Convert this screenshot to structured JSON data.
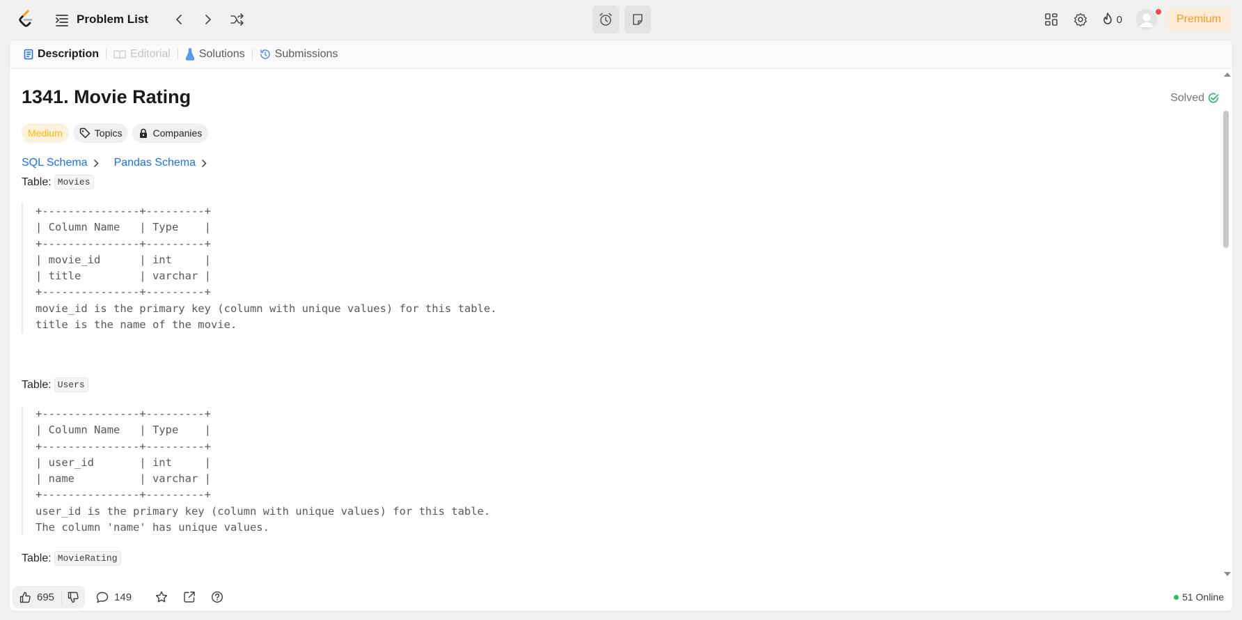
{
  "nav": {
    "logo_icon": "leetcode-logo",
    "problem_list_label": "Problem List",
    "streak_count": "0",
    "premium_label": "Premium"
  },
  "tabs": [
    {
      "label": "Description",
      "icon": "document-icon",
      "state": "active"
    },
    {
      "label": "Editorial",
      "icon": "book-icon",
      "state": "disabled"
    },
    {
      "label": "Solutions",
      "icon": "flask-icon",
      "state": "normal"
    },
    {
      "label": "Submissions",
      "icon": "history-icon",
      "state": "normal"
    }
  ],
  "problem": {
    "title": "1341. Movie Rating",
    "status": "Solved",
    "difficulty": "Medium",
    "topics_label": "Topics",
    "companies_label": "Companies",
    "sql_schema_label": "SQL Schema",
    "pandas_schema_label": "Pandas Schema"
  },
  "tables": [
    {
      "label": "Table:",
      "name": "Movies",
      "schema": "+---------------+---------+\n| Column Name   | Type    |\n+---------------+---------+\n| movie_id      | int     |\n| title         | varchar |\n+---------------+---------+\nmovie_id is the primary key (column with unique values) for this table.\ntitle is the name of the movie."
    },
    {
      "label": "Table:",
      "name": "Users",
      "schema": "+---------------+---------+\n| Column Name   | Type    |\n+---------------+---------+\n| user_id       | int     |\n| name          | varchar |\n+---------------+---------+\nuser_id is the primary key (column with unique values) for this table.\nThe column 'name' has unique values."
    },
    {
      "label": "Table:",
      "name": "MovieRating",
      "schema": ""
    }
  ],
  "footer": {
    "likes": "695",
    "comments": "149",
    "online": "51 Online"
  },
  "colors": {
    "medium": "#ffb800",
    "solved": "#2cbb5d",
    "link": "#1a73e8",
    "premium": "#f59a23"
  }
}
